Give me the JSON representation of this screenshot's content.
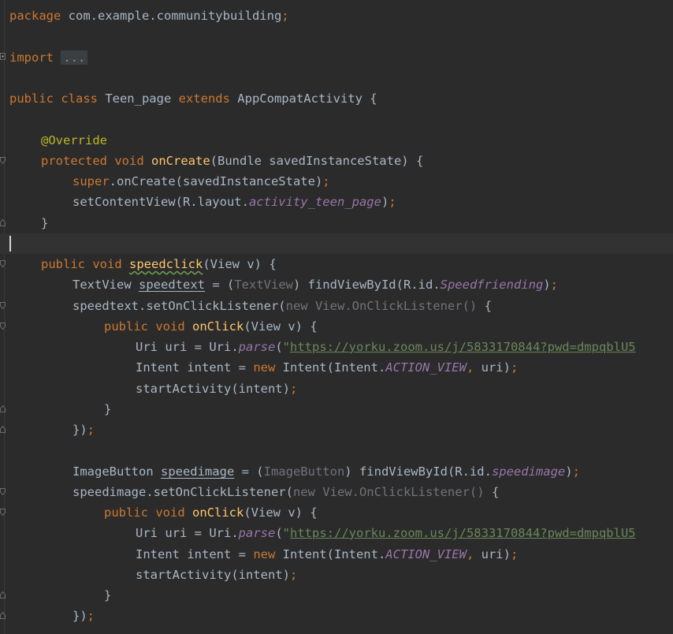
{
  "editor": {
    "line1": {
      "kw": "package",
      "pkg": " com.example.communitybuilding",
      "semi": ";"
    },
    "line2": {
      "kw": "import",
      "folded": "..."
    },
    "line3": {
      "kw": "public class",
      "name": " Teen_page ",
      "kw2": "extends",
      "rest": " AppCompatActivity {"
    },
    "line4": {
      "ann": "@Override"
    },
    "line5": {
      "kw": "protected void",
      "sp": " ",
      "fn": "onCreate",
      "rest": "(Bundle savedInstanceState) {"
    },
    "line6": {
      "kw": "super",
      "rest": ".onCreate(savedInstanceState)",
      "semi": ";"
    },
    "line7": {
      "a": "setContentView(R.layout.",
      "it": "activity_teen_page",
      "b": ")",
      "semi": ";"
    },
    "line8": {
      "brace": "}"
    },
    "line9": {
      "kw": "public void",
      "sp": " ",
      "fn": "speedclick",
      "rest": "(View v) {"
    },
    "line10": {
      "a": "TextView ",
      "var": "speedtext",
      "b": " = (",
      "gr": "TextView",
      "c": ") findViewById(R.id.",
      "it": "Speedfriending",
      "d": ")",
      "semi": ";"
    },
    "line11": {
      "a": "speedtext.setOnClickListener(",
      "gr": "new View.OnClickListener()",
      "b": " {"
    },
    "line12": {
      "kw": "public void",
      "sp": " ",
      "fn": "onClick",
      "rest": "(View v) {"
    },
    "line13": {
      "a": "Uri uri = Uri.",
      "it": "parse",
      "b": "(",
      "q": "\"",
      "url": "https://yorku.zoom.us/j/5833170844?pwd=dmpqblU5"
    },
    "line14": {
      "a": "Intent intent = ",
      "kw": "new",
      "b": " Intent(Intent.",
      "it": "ACTION_VIEW",
      "comma": ",",
      "c": " uri)",
      "semi": ";"
    },
    "line15": {
      "a": "startActivity(intent)",
      "semi": ";"
    },
    "line16": {
      "brace": "}"
    },
    "line17": {
      "a": "})",
      "semi": ";"
    },
    "line18": {
      "a": "ImageButton ",
      "var": "speedimage",
      "b": " = (",
      "gr": "ImageButton",
      "c": ") findViewById(R.id.",
      "it": "speedimage",
      "d": ")",
      "semi": ";"
    },
    "line19": {
      "a": "speedimage.setOnClickListener(",
      "gr": "new View.OnClickListener()",
      "b": " {"
    },
    "line20": {
      "kw": "public void",
      "sp": " ",
      "fn": "onClick",
      "rest": "(View v) {"
    },
    "line21": {
      "a": "Uri uri = Uri.",
      "it": "parse",
      "b": "(",
      "q": "\"",
      "url": "https://yorku.zoom.us/j/5833170844?pwd=dmpqblU5"
    },
    "line22": {
      "a": "Intent intent = ",
      "kw": "new",
      "b": " Intent(Intent.",
      "it": "ACTION_VIEW",
      "comma": ",",
      "c": " uri)",
      "semi": ";"
    },
    "line23": {
      "a": "startActivity(intent)",
      "semi": ";"
    },
    "line24": {
      "brace": "}"
    },
    "line25": {
      "a": "})",
      "semi": ";"
    }
  }
}
